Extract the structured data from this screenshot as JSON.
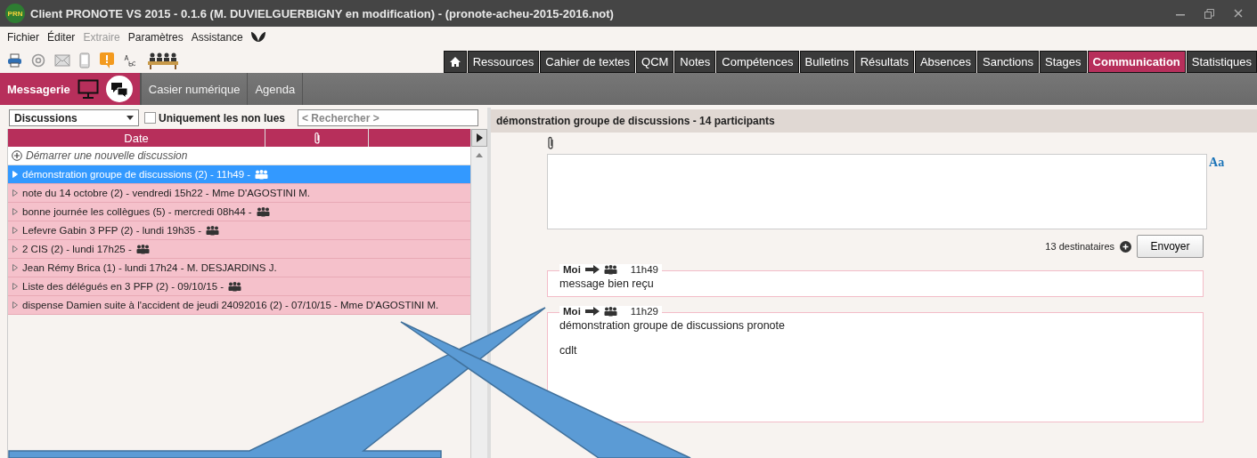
{
  "window": {
    "logo": "PRN",
    "title": "Client PRONOTE VS 2015 - 0.1.6 (M. DUVIELGUERBIGNY en modification) - (pronote-acheu-2015-2016.not)"
  },
  "menu": [
    {
      "label": "Fichier",
      "disabled": false
    },
    {
      "label": "Éditer",
      "disabled": false
    },
    {
      "label": "Extraire",
      "disabled": true
    },
    {
      "label": "Paramètres",
      "disabled": false
    },
    {
      "label": "Assistance",
      "disabled": false
    }
  ],
  "tabs": [
    {
      "label": "Ressources",
      "selected": false
    },
    {
      "label": "Cahier de textes",
      "selected": false
    },
    {
      "label": "QCM",
      "selected": false
    },
    {
      "label": "Notes",
      "selected": false
    },
    {
      "label": "Compétences",
      "selected": false
    },
    {
      "label": "Bulletins",
      "selected": false
    },
    {
      "label": "Résultats",
      "selected": false
    },
    {
      "label": "Absences",
      "selected": false
    },
    {
      "label": "Sanctions",
      "selected": false
    },
    {
      "label": "Stages",
      "selected": false
    },
    {
      "label": "Communication",
      "selected": true
    },
    {
      "label": "Statistiques",
      "selected": false
    }
  ],
  "subtabs": [
    {
      "label": "Messagerie",
      "selected": true
    },
    {
      "label": "Casier numérique",
      "selected": false
    },
    {
      "label": "Agenda",
      "selected": false
    }
  ],
  "filter": {
    "dropdown": "Discussions",
    "unread_only": {
      "label": "Uniquement les non lues",
      "checked": false
    },
    "search_placeholder": "< Rechercher >"
  },
  "list": {
    "columns": [
      "Date"
    ],
    "new_item": "Démarrer une nouvelle discussion",
    "rows": [
      {
        "label": "démonstration groupe de discussions (2) - 11h49 -",
        "kind": "group",
        "selected": true
      },
      {
        "label": "note du 14 octobre (2) - vendredi 15h22 - Mme D'AGOSTINI M.",
        "kind": "person",
        "selected": false
      },
      {
        "label": "bonne journée les collègues (5) - mercredi 08h44 -",
        "kind": "group",
        "selected": false
      },
      {
        "label": "Lefevre Gabin 3 PFP (2) - lundi 19h35 -",
        "kind": "group",
        "selected": false
      },
      {
        "label": "2 CIS (2) - lundi 17h25 -",
        "kind": "group",
        "selected": false
      },
      {
        "label": "Jean Rémy Brica (1) - lundi 17h24 - M. DESJARDINS J.",
        "kind": "person",
        "selected": false
      },
      {
        "label": "Liste des délégués en 3 PFP (2) - 09/10/15 -",
        "kind": "group",
        "selected": false
      },
      {
        "label": "dispense Damien suite à l'accident de jeudi 24092016 (2) - 07/10/15 - Mme D'AGOSTINI M.",
        "kind": "person",
        "selected": false
      }
    ]
  },
  "conversation": {
    "title": "démonstration groupe de discussions - 14 participants",
    "format_button": "Aa",
    "recipients": "13 destinataires",
    "send_button": "Envoyer",
    "messages": [
      {
        "author": "Moi",
        "time": "11h49",
        "lines": [
          "message bien reçu"
        ]
      },
      {
        "author": "Moi",
        "time": "11h29",
        "lines": [
          "démonstration groupe de discussions pronote",
          "cdlt"
        ]
      }
    ]
  }
}
